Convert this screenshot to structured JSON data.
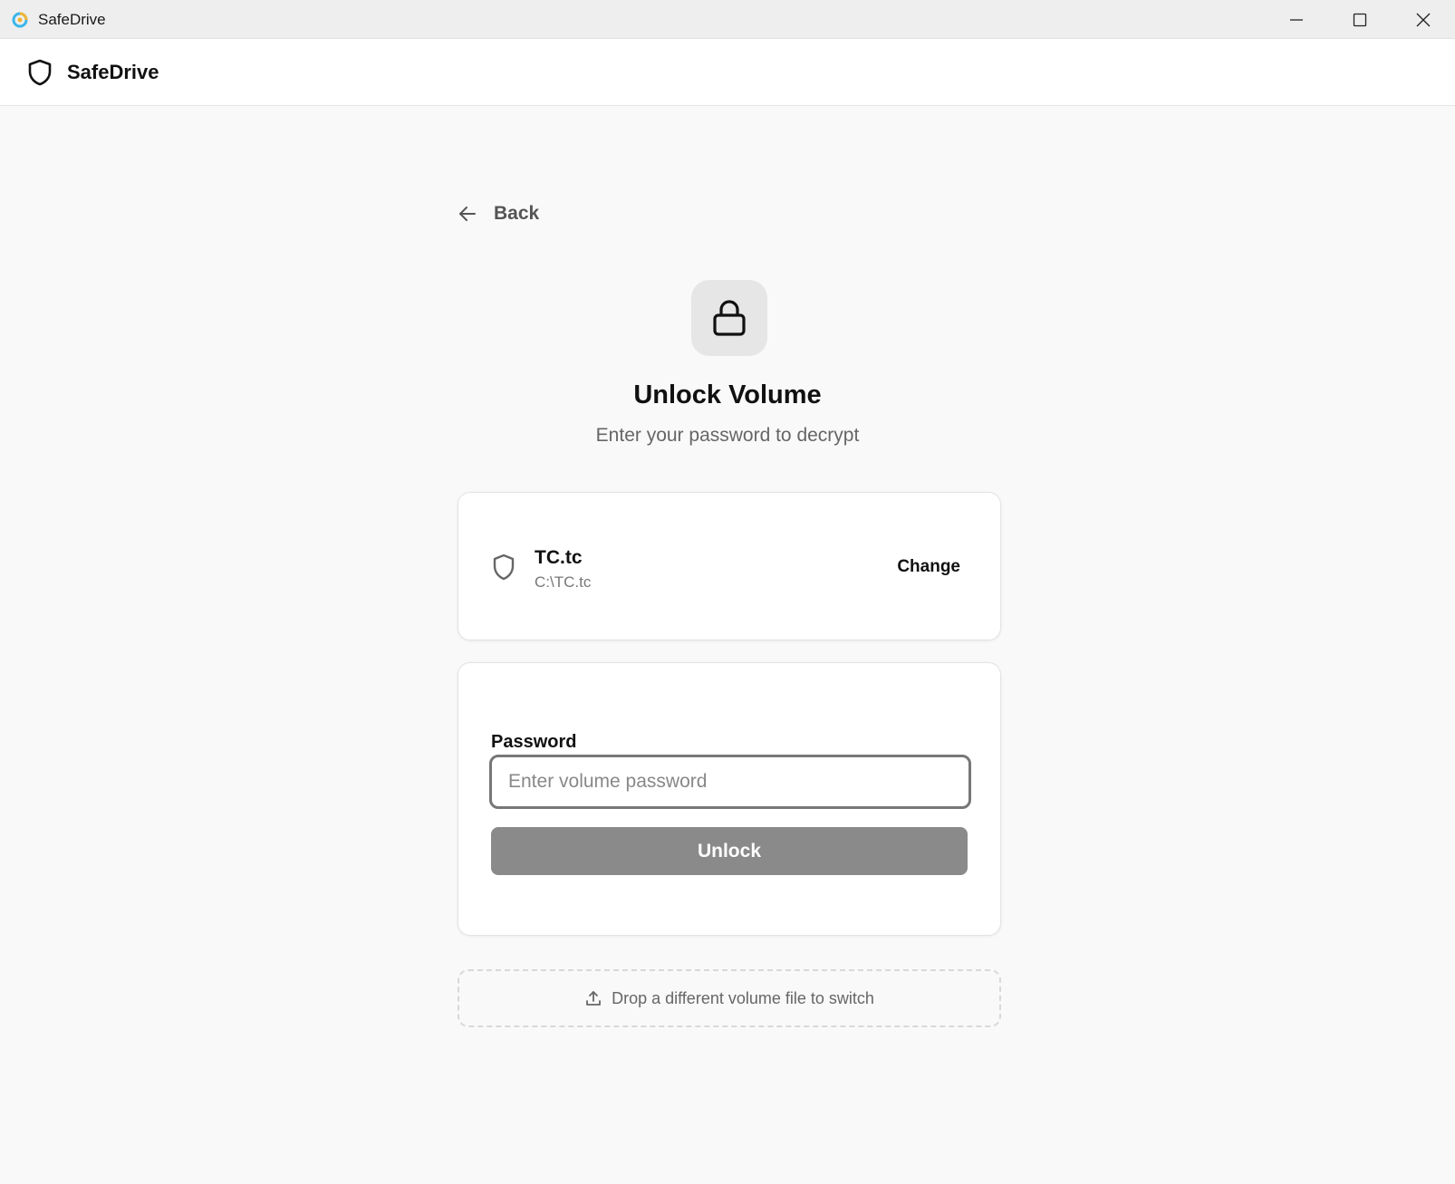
{
  "window": {
    "title": "SafeDrive",
    "app_icon": "safedrive-app-icon",
    "controls": [
      "minimize-icon",
      "maximize-icon",
      "close-icon"
    ]
  },
  "header": {
    "app_name": "SafeDrive",
    "logo_icon": "shield-icon"
  },
  "nav": {
    "back_label": "Back",
    "back_icon": "arrow-left-icon"
  },
  "hero": {
    "icon": "lock-icon",
    "title": "Unlock Volume",
    "subtitle": "Enter your password to decrypt"
  },
  "volume": {
    "icon": "shield-icon",
    "name": "TC.tc",
    "path": "C:\\TC.tc",
    "change_label": "Change"
  },
  "password_form": {
    "label": "Password",
    "value": "",
    "placeholder": "Enter volume password",
    "submit_label": "Unlock"
  },
  "drop_zone": {
    "icon": "upload-icon",
    "label": "Drop a different volume file to switch"
  },
  "colors": {
    "background": "#f9f9f9",
    "card": "#ffffff",
    "button_disabled": "#8a8a8b",
    "input_border": "#777777"
  }
}
